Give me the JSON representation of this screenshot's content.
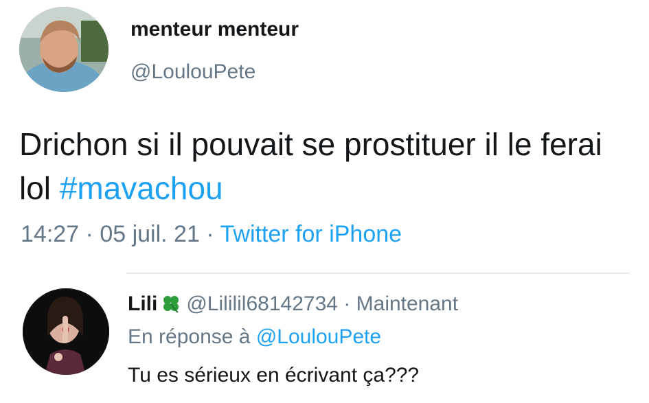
{
  "tweet": {
    "display_name": "menteur menteur",
    "handle": "@LoulouPete",
    "text_before_hashtag": "Drichon si il pouvait se prostituer il le ferai lol ",
    "hashtag": "#mavachou",
    "time": "14:27",
    "date": "05 juil. 21",
    "separator": "·",
    "source": "Twitter for iPhone"
  },
  "reply": {
    "display_name": "Lili",
    "name_emoji_icon": "four-leaf-clover-icon",
    "handle": "@Lililil68142734",
    "separator": "·",
    "time": "Maintenant",
    "in_reply_to_label": "En réponse à",
    "in_reply_to_handle": "@LoulouPete",
    "text": "Tu es sérieux en écrivant ça???"
  },
  "colors": {
    "link": "#1da1f2",
    "secondary_text": "#657786",
    "primary_text": "#14171a",
    "divider": "#e6ecf0",
    "clover": "#2e9e3a"
  }
}
